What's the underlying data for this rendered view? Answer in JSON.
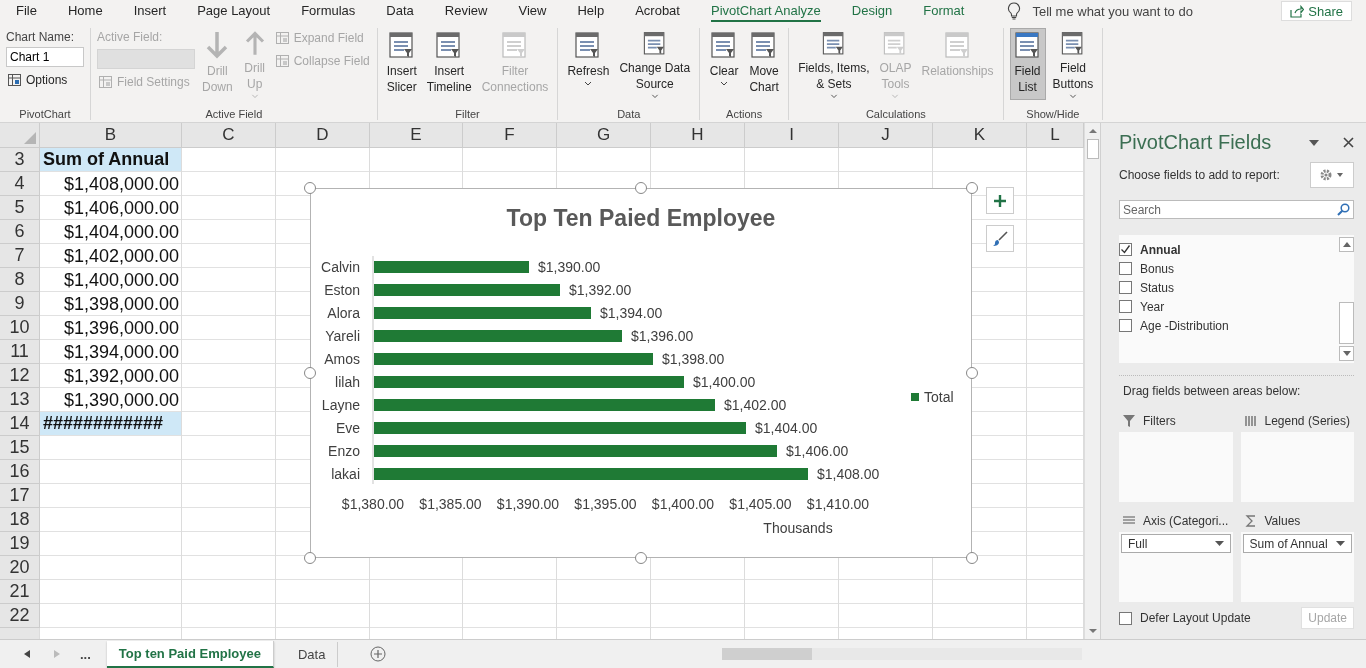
{
  "menu": {
    "tabs": [
      {
        "label": "File",
        "selected": false,
        "contextual": false
      },
      {
        "label": "Home",
        "selected": false,
        "contextual": false
      },
      {
        "label": "Insert",
        "selected": false,
        "contextual": false
      },
      {
        "label": "Page Layout",
        "selected": false,
        "contextual": false
      },
      {
        "label": "Formulas",
        "selected": false,
        "contextual": false
      },
      {
        "label": "Data",
        "selected": false,
        "contextual": false
      },
      {
        "label": "Review",
        "selected": false,
        "contextual": false
      },
      {
        "label": "View",
        "selected": false,
        "contextual": false
      },
      {
        "label": "Help",
        "selected": false,
        "contextual": false
      },
      {
        "label": "Acrobat",
        "selected": false,
        "contextual": false
      },
      {
        "label": "PivotChart Analyze",
        "selected": true,
        "contextual": true
      },
      {
        "label": "Design",
        "selected": false,
        "contextual": true
      },
      {
        "label": "Format",
        "selected": false,
        "contextual": true
      }
    ],
    "tell_me": {
      "placeholder": "Tell me what you want to do"
    },
    "share": "Share"
  },
  "ribbon": {
    "groups": [
      {
        "label": "PivotChart",
        "columns": [
          [
            {
              "kind": "name_field",
              "label": "Chart Name:",
              "value": "Chart 1"
            },
            {
              "kind": "small",
              "label": "Options",
              "disabled": false
            }
          ]
        ]
      },
      {
        "label": "Active Field",
        "columns": [
          [
            {
              "kind": "active_field",
              "label": "Active Field:",
              "disabled": true
            },
            {
              "kind": "small",
              "label": "Field Settings",
              "disabled": true
            }
          ],
          [
            {
              "kind": "large",
              "lines": [
                "Drill",
                "Down"
              ],
              "disabled": true,
              "dropdown": false,
              "selected": false
            }
          ],
          [
            {
              "kind": "large",
              "lines": [
                "Drill",
                "Up"
              ],
              "disabled": true,
              "dropdown": true,
              "selected": false
            }
          ],
          [
            {
              "kind": "small",
              "label": "Expand Field",
              "disabled": true
            },
            {
              "kind": "small",
              "label": "Collapse Field",
              "disabled": true
            }
          ]
        ]
      },
      {
        "label": "Filter",
        "columns": [
          [
            {
              "kind": "large",
              "lines": [
                "Insert",
                "Slicer"
              ],
              "disabled": false,
              "dropdown": false,
              "selected": false
            }
          ],
          [
            {
              "kind": "large",
              "lines": [
                "Insert",
                "Timeline"
              ],
              "disabled": false,
              "dropdown": false,
              "selected": false
            }
          ],
          [
            {
              "kind": "large",
              "lines": [
                "Filter",
                "Connections"
              ],
              "disabled": true,
              "dropdown": false,
              "selected": false
            }
          ]
        ]
      },
      {
        "label": "Data",
        "columns": [
          [
            {
              "kind": "large",
              "lines": [
                "Refresh"
              ],
              "disabled": false,
              "dropdown": true,
              "selected": false
            }
          ],
          [
            {
              "kind": "large",
              "lines": [
                "Change Data",
                "Source"
              ],
              "disabled": false,
              "dropdown": true,
              "selected": false
            }
          ]
        ]
      },
      {
        "label": "Actions",
        "columns": [
          [
            {
              "kind": "large",
              "lines": [
                "Clear"
              ],
              "disabled": false,
              "dropdown": true,
              "selected": false
            }
          ],
          [
            {
              "kind": "large",
              "lines": [
                "Move",
                "Chart"
              ],
              "disabled": false,
              "dropdown": false,
              "selected": false
            }
          ]
        ]
      },
      {
        "label": "Calculations",
        "columns": [
          [
            {
              "kind": "large",
              "lines": [
                "Fields, Items,",
                "& Sets"
              ],
              "disabled": false,
              "dropdown": true,
              "selected": false
            }
          ],
          [
            {
              "kind": "large",
              "lines": [
                "OLAP",
                "Tools"
              ],
              "disabled": true,
              "dropdown": true,
              "selected": false
            }
          ],
          [
            {
              "kind": "large",
              "lines": [
                "Relationships"
              ],
              "disabled": true,
              "dropdown": false,
              "selected": false
            }
          ]
        ]
      },
      {
        "label": "Show/Hide",
        "columns": [
          [
            {
              "kind": "large",
              "lines": [
                "Field",
                "List"
              ],
              "disabled": false,
              "dropdown": false,
              "selected": true
            }
          ],
          [
            {
              "kind": "large",
              "lines": [
                "Field",
                "Buttons"
              ],
              "disabled": false,
              "dropdown": true,
              "selected": false
            }
          ]
        ]
      }
    ]
  },
  "sheet": {
    "columns": [
      "B",
      "C",
      "D",
      "E",
      "F",
      "G",
      "H",
      "I",
      "J",
      "K",
      "L"
    ],
    "rows": [
      {
        "number": "3",
        "value": "Sum of Annual",
        "kind": "header"
      },
      {
        "number": "4",
        "value": "$1,408,000.00",
        "kind": "value"
      },
      {
        "number": "5",
        "value": "$1,406,000.00",
        "kind": "value"
      },
      {
        "number": "6",
        "value": "$1,404,000.00",
        "kind": "value"
      },
      {
        "number": "7",
        "value": "$1,402,000.00",
        "kind": "value"
      },
      {
        "number": "8",
        "value": "$1,400,000.00",
        "kind": "value"
      },
      {
        "number": "9",
        "value": "$1,398,000.00",
        "kind": "value"
      },
      {
        "number": "10",
        "value": "$1,396,000.00",
        "kind": "value"
      },
      {
        "number": "11",
        "value": "$1,394,000.00",
        "kind": "value"
      },
      {
        "number": "12",
        "value": "$1,392,000.00",
        "kind": "value"
      },
      {
        "number": "13",
        "value": "$1,390,000.00",
        "kind": "value"
      },
      {
        "number": "14",
        "value": "############",
        "kind": "total"
      },
      {
        "number": "15",
        "kind": "empty"
      },
      {
        "number": "16",
        "kind": "empty"
      },
      {
        "number": "17",
        "kind": "empty"
      },
      {
        "number": "18",
        "kind": "empty"
      },
      {
        "number": "19",
        "kind": "empty"
      },
      {
        "number": "20",
        "kind": "empty"
      },
      {
        "number": "21",
        "kind": "empty"
      },
      {
        "number": "22",
        "kind": "empty"
      }
    ]
  },
  "chart": {
    "chart_data": {
      "type": "bar",
      "orientation": "horizontal",
      "title": "Top Ten Paied Employee",
      "xlabel": "Thousands",
      "categories": [
        "Calvin",
        "Eston",
        "Alora",
        "Yareli",
        "Amos",
        "lilah",
        "Layne",
        "Eve",
        "Enzo",
        "lakai"
      ],
      "series": [
        {
          "name": "Total",
          "color": "#1f7a35",
          "values": [
            1390,
            1392,
            1394,
            1396,
            1398,
            1400,
            1402,
            1404,
            1406,
            1408
          ]
        }
      ],
      "value_labels": [
        "$1,390.00",
        "$1,392.00",
        "$1,394.00",
        "$1,396.00",
        "$1,398.00",
        "$1,400.00",
        "$1,402.00",
        "$1,404.00",
        "$1,406.00",
        "$1,408.00"
      ],
      "xlim": [
        1380,
        1410
      ],
      "xticks": [
        {
          "value": 1380,
          "label": "$1,380.00"
        },
        {
          "value": 1385,
          "label": "$1,385.00"
        },
        {
          "value": 1390,
          "label": "$1,390.00"
        },
        {
          "value": 1395,
          "label": "$1,395.00"
        },
        {
          "value": 1400,
          "label": "$1,400.00"
        },
        {
          "value": 1405,
          "label": "$1,405.00"
        },
        {
          "value": 1410,
          "label": "$1,410.00"
        }
      ]
    }
  },
  "panel": {
    "title": "PivotChart Fields",
    "prompt": "Choose fields to add to report:",
    "search": {
      "placeholder": "Search"
    },
    "fields": [
      {
        "label": "Annual",
        "checked": true
      },
      {
        "label": "Bonus",
        "checked": false
      },
      {
        "label": "Status",
        "checked": false
      },
      {
        "label": "Year",
        "checked": false
      },
      {
        "label": "Age -Distribution",
        "checked": false
      }
    ],
    "drag_hint": "Drag fields between areas below:",
    "areas": [
      {
        "label": "Filters",
        "kind": "filters"
      },
      {
        "label": "Legend (Series)",
        "kind": "legend"
      },
      {
        "label": "Axis (Categori...",
        "kind": "axis",
        "item": "Full"
      },
      {
        "label": "Values",
        "kind": "values",
        "item": "Sum of Annual"
      }
    ],
    "defer": {
      "label": "Defer Layout Update",
      "checked": false
    },
    "update": {
      "label": "Update",
      "disabled": true
    }
  },
  "sheet_tabs": {
    "more": "...",
    "tabs": [
      {
        "label": "Top ten Paid Employee",
        "selected": true
      },
      {
        "label": "Data",
        "selected": false
      }
    ]
  }
}
